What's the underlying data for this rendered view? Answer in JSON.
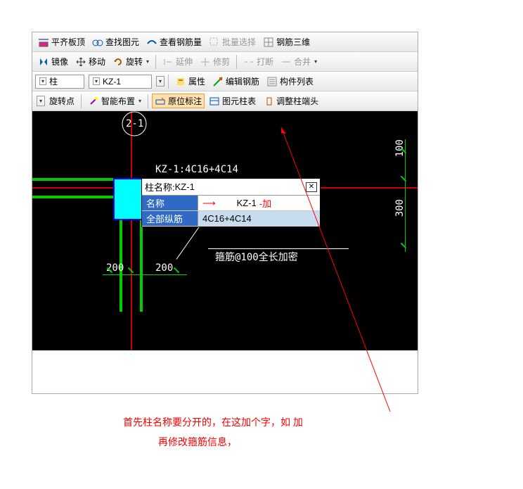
{
  "toolbar1": {
    "item1": "平齐板顶",
    "item2": "查找图元",
    "item3": "查看钢筋量",
    "item4": "批量选择",
    "item5": "钢筋三维"
  },
  "toolbar2": {
    "mirror": "镜像",
    "move": "移动",
    "rotate": "旋转",
    "extend": "延伸",
    "trim": "修剪",
    "break": "打断",
    "merge": "合并"
  },
  "toolbar3": {
    "select1": "柱",
    "select2": "KZ-1",
    "props": "属性",
    "edit_rebar": "编辑钢筋",
    "comp_list": "构件列表"
  },
  "toolbar4": {
    "rotate_point": "旋转点",
    "smart_layout": "智能布置",
    "inplace_label": "原位标注",
    "elem_table": "图元柱表",
    "adjust_end": "调整柱端头"
  },
  "canvas": {
    "label_top": "2-1",
    "rebar_spec": "KZ-1:4C16+4C14",
    "stirrup_note": "箍筋@100全长加密",
    "dim_200a": "200",
    "dim_200b": "200",
    "dim_100": "100",
    "dim_300": "300"
  },
  "popup": {
    "title_prefix": "柱名称: ",
    "title_value": "KZ-1",
    "row1_label": "名称",
    "row1_value": "KZ-1",
    "row1_suffix": "-加",
    "row2_label": "全部纵筋",
    "row2_value": "4C16+4C14"
  },
  "annotation": {
    "line1": "首先柱名称要分开的，在这加个字，如   加",
    "line2": "再修改箍筋信息，"
  }
}
